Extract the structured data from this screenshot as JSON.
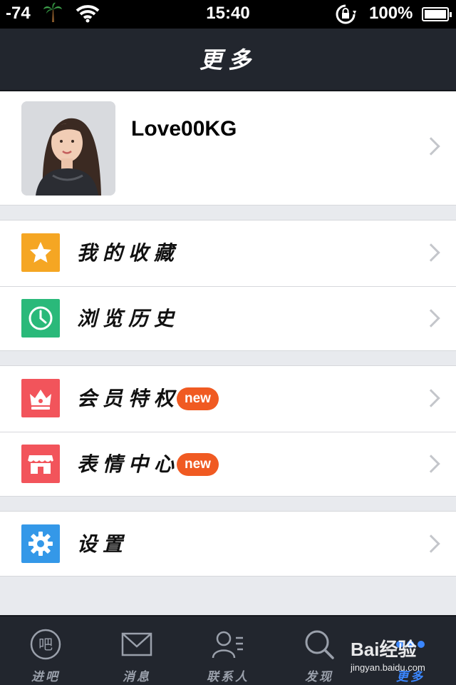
{
  "status_bar": {
    "signal": "-74",
    "time": "15:40",
    "battery_percent": "100%",
    "carrier_icon": "palm-tree-icon",
    "wifi_icon": "wifi-icon",
    "lock_icon": "orientation-lock-icon"
  },
  "nav": {
    "title": "更多"
  },
  "profile": {
    "username": "Love00KG"
  },
  "menu": {
    "favorites": {
      "label": "我的收藏",
      "icon": "star-icon",
      "color": "#f5a623"
    },
    "history": {
      "label": "浏览历史",
      "icon": "clock-icon",
      "color": "#2ab97a"
    },
    "vip": {
      "label": "会员特权",
      "icon": "crown-icon",
      "color": "#f2545b",
      "badge": "new"
    },
    "stickers": {
      "label": "表情中心",
      "icon": "shop-icon",
      "color": "#f2545b",
      "badge": "new"
    },
    "settings": {
      "label": "设置",
      "icon": "gear-icon",
      "color": "#3498e8"
    }
  },
  "tabs": [
    {
      "label": "进吧",
      "icon": "bar-icon"
    },
    {
      "label": "消息",
      "icon": "mail-icon"
    },
    {
      "label": "联系人",
      "icon": "contacts-icon"
    },
    {
      "label": "发现",
      "icon": "search-icon"
    },
    {
      "label": "更多",
      "icon": "more-icon",
      "active": true
    }
  ],
  "watermark": {
    "logo": "Bai经验",
    "url": "jingyan.baidu.com"
  },
  "colors": {
    "nav_bg": "#22262e",
    "accent": "#3a86ff",
    "badge": "#f05a22"
  }
}
